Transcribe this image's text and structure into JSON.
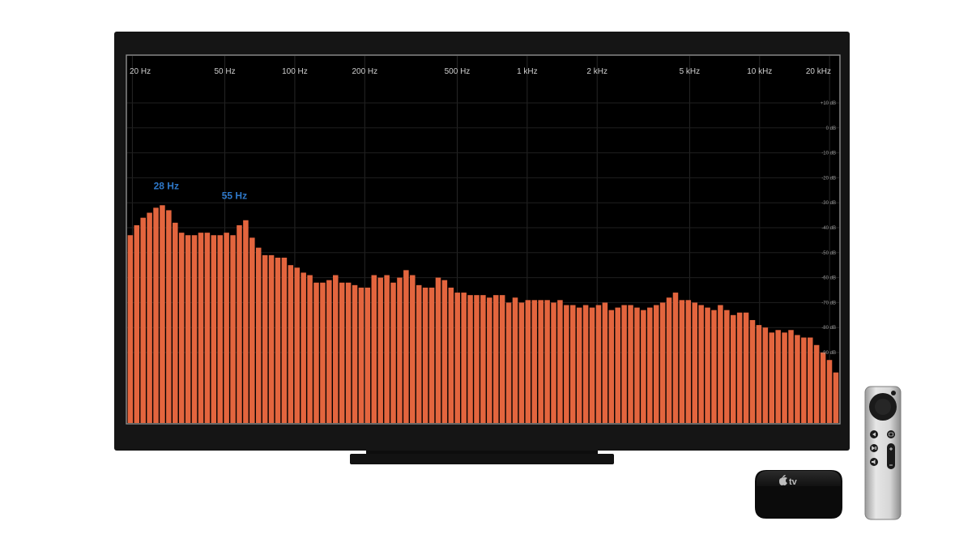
{
  "chart_data": {
    "type": "bar",
    "title": "",
    "xlabel": "",
    "ylabel": "",
    "x_scale": "log",
    "xlim_hz": [
      19,
      22000
    ],
    "ylim_db": [
      -110,
      20
    ],
    "grid": true,
    "x_tick_labels": [
      {
        "hz": 20,
        "label": "20 Hz"
      },
      {
        "hz": 50,
        "label": "50 Hz"
      },
      {
        "hz": 100,
        "label": "100 Hz"
      },
      {
        "hz": 200,
        "label": "200 Hz"
      },
      {
        "hz": 500,
        "label": "500 Hz"
      },
      {
        "hz": 1000,
        "label": "1 kHz"
      },
      {
        "hz": 2000,
        "label": "2 kHz"
      },
      {
        "hz": 5000,
        "label": "5 kHz"
      },
      {
        "hz": 10000,
        "label": "10 kHz"
      },
      {
        "hz": 20000,
        "label": "20 kHz"
      }
    ],
    "y_tick_labels": [
      {
        "db": 10,
        "label": "+10 dB"
      },
      {
        "db": 0,
        "label": "0 dB"
      },
      {
        "db": -10,
        "label": "-10 dB"
      },
      {
        "db": -20,
        "label": "-20 dB"
      },
      {
        "db": -30,
        "label": "-30 dB"
      },
      {
        "db": -40,
        "label": "-40 dB"
      },
      {
        "db": -50,
        "label": "-50 dB"
      },
      {
        "db": -60,
        "label": "-60 dB"
      },
      {
        "db": -70,
        "label": "-70 dB"
      },
      {
        "db": -80,
        "label": "-80 dB"
      },
      {
        "db": -90,
        "label": "-90 dB"
      }
    ],
    "peak_annotations": [
      {
        "hz": 28,
        "label": "28 Hz",
        "db": -31
      },
      {
        "hz": 55,
        "label": "55 Hz",
        "db": -35
      }
    ],
    "series": [
      {
        "values": [
          -43,
          -39,
          -36,
          -34,
          -32,
          -31,
          -33,
          -38,
          -42,
          -43,
          -43,
          -42,
          -42,
          -43,
          -43,
          -42,
          -43,
          -39,
          -37,
          -44,
          -48,
          -51,
          -51,
          -52,
          -52,
          -55,
          -56,
          -58,
          -59,
          -62,
          -62,
          -61,
          -59,
          -62,
          -62,
          -63,
          -64,
          -64,
          -59,
          -60,
          -59,
          -62,
          -60,
          -57,
          -59,
          -63,
          -64,
          -64,
          -60,
          -61,
          -64,
          -66,
          -66,
          -67,
          -67,
          -67,
          -68,
          -67,
          -67,
          -70,
          -68,
          -70,
          -69,
          -69,
          -69,
          -69,
          -70,
          -69,
          -71,
          -71,
          -72,
          -71,
          -72,
          -71,
          -70,
          -73,
          -72,
          -71,
          -71,
          -72,
          -73,
          -72,
          -71,
          -70,
          -68,
          -66,
          -69,
          -69,
          -70,
          -71,
          -72,
          -73,
          -71,
          -73,
          -75,
          -74,
          -74,
          -77,
          -79,
          -80,
          -82,
          -81,
          -82,
          -81,
          -83,
          -84,
          -84,
          -87,
          -90,
          -93,
          -98
        ]
      }
    ]
  },
  "colors": {
    "bars": "#E3653E",
    "annotation": "#2E78C9",
    "axis_text": "#CFCFCF",
    "screen": "#000000",
    "bezel": "#151515"
  },
  "devices": {
    "box_logo_icon": "apple-logo-icon",
    "box_text": "tv"
  }
}
